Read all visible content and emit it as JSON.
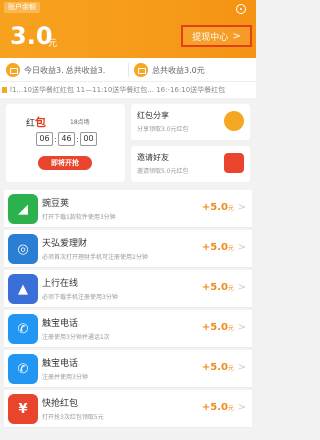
{
  "header": {
    "account_tag": "账户余额",
    "balance": "3.0",
    "balance_unit": "元",
    "withdraw_label": "提现中心",
    "withdraw_chevron": ">"
  },
  "earnings": {
    "today": "今日收益3.",
    "today_total": "总共收益3.",
    "total": "总共收益3.0元"
  },
  "marquee": "l1...10送华餐红红包    11—11:10送华餐红包...    16:-16:10送华餐红包",
  "promo": {
    "title_prefix": "红",
    "title_highlight": "包",
    "time_label": "18点场",
    "timer": [
      "06",
      "46",
      "00"
    ],
    "timer_sep": ":",
    "grab_label": "即将开抢",
    "share_title": "红包分享",
    "share_sub": "分享领取3.0元红包",
    "invite_title": "邀请好友",
    "invite_sub": "邀请领取5.0元红包"
  },
  "tasks": [
    {
      "name": "豌豆荚",
      "desc": "打开下载1款软件使用3分钟",
      "reward": "+5.0",
      "unit": "元",
      "icon": "pea-pod-icon",
      "color": "#2bb24c"
    },
    {
      "name": "天弘爱理财",
      "desc": "必须首次打开理财手机可注册使用2分钟",
      "reward": "+5.0",
      "unit": "元",
      "icon": "finance-icon",
      "color": "#2a7fd4"
    },
    {
      "name": "上行在线",
      "desc": "必须下载手机注册使用3分钟",
      "reward": "+5.0",
      "unit": "元",
      "icon": "shangxing-icon",
      "color": "#3a6fd8"
    },
    {
      "name": "触宝电话",
      "desc": "注册使用3分钟并通话1次",
      "reward": "+5.0",
      "unit": "元",
      "icon": "phone-icon",
      "color": "#2196f3"
    },
    {
      "name": "触宝电话",
      "desc": "注册并使用3分钟",
      "reward": "+5.0",
      "unit": "元",
      "icon": "phone-icon",
      "color": "#2196f3"
    },
    {
      "name": "快抢红包",
      "desc": "打开抢3次红包领取5元",
      "reward": "+5.0",
      "unit": "元",
      "icon": "redpacket-icon",
      "color": "#e8452c"
    }
  ],
  "arrow": ">"
}
